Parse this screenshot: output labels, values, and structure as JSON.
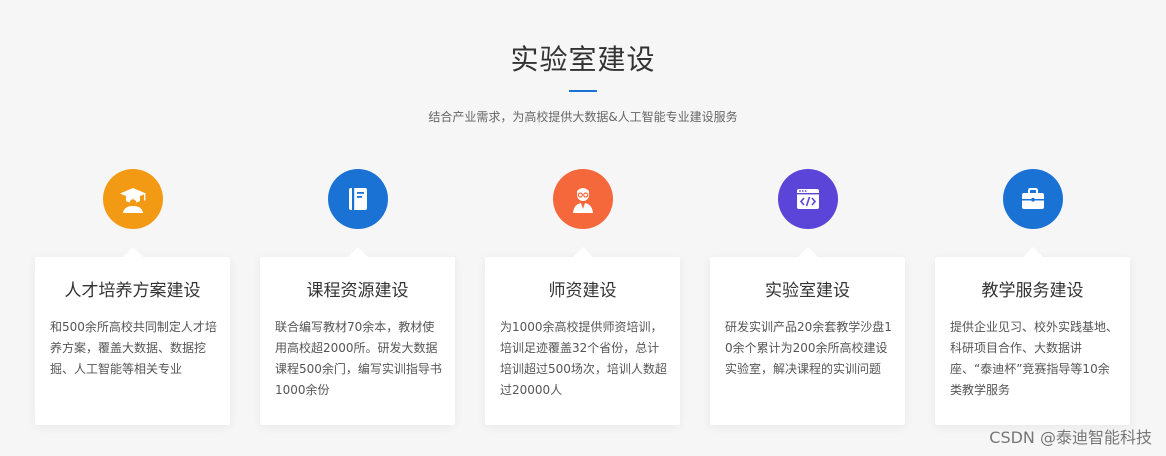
{
  "section": {
    "title": "实验室建设",
    "subtitle": "结合产业需求，为高校提供大数据&人工智能专业建设服务"
  },
  "cards": [
    {
      "icon": "graduate-icon",
      "color": "#f39a14",
      "title": "人才培养方案建设",
      "desc": "和500余所高校共同制定人才培养方案，覆盖大数据、数据挖掘、人工智能等相关专业"
    },
    {
      "icon": "book-icon",
      "color": "#1a73d4",
      "title": "课程资源建设",
      "desc": "联合编写教材70余本，教材使用高校超2000所。研发大数据课程500余门，编写实训指导书1000余份"
    },
    {
      "icon": "teacher-icon",
      "color": "#f4683c",
      "title": "师资建设",
      "desc": "为1000余高校提供师资培训，培训足迹覆盖32个省份，总计培训超过500场次，培训人数超过20000人"
    },
    {
      "icon": "code-window-icon",
      "color": "#5b44d8",
      "title": "实验室建设",
      "desc": "研发实训产品20余套教学沙盘10余个累计为200余所高校建设实验室，解决课程的实训问题"
    },
    {
      "icon": "briefcase-icon",
      "color": "#1a73d4",
      "title": "教学服务建设",
      "desc": "提供企业见习、校外实践基地、科研项目合作、大数据讲座、“泰迪杯”竞赛指导等10余类教学服务"
    }
  ],
  "watermark": "CSDN @泰迪智能科技"
}
